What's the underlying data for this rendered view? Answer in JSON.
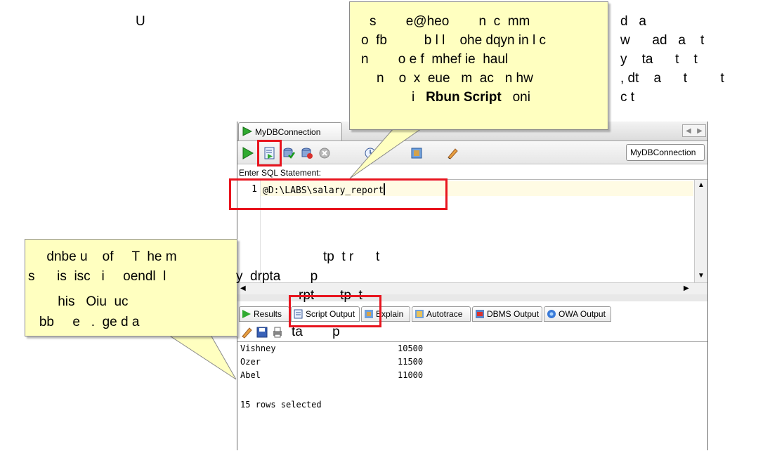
{
  "slide_text": {
    "top_left_fragment": "U",
    "right_fragments": [
      "d   a",
      "w      ad   a    t",
      "y    ta      t    t",
      ", dt    a      t         t",
      "c t"
    ]
  },
  "callout_top": {
    "lines": [
      "s        e@heo        n  c  mm",
      "o  fb          b l l    ohe dqyn in l c",
      "n        o e f  mhef ie  haul",
      "n    o  x  eue   m  ac   n hw"
    ],
    "last_line_pre": "i   ",
    "last_line_bold": "Rbun Script",
    "last_line_post": "   oni"
  },
  "callout_left": {
    "lines": [
      "     dnbe u    of     T  he m",
      "s      is  isc   i     oendl  l",
      "        his   Oiu  uc",
      "   bb     e   .  ge d a"
    ]
  },
  "overlay_fragments": {
    "mid1": "tp  t r      t",
    "mid2": "y  drpta        p",
    "mid3": "rpt       tp  t",
    "mid4": "ta        p"
  },
  "window": {
    "doc_tab_label": "MyDBConnection",
    "connection_selector": "MyDBConnection",
    "enter_sql_label": "Enter SQL Statement:",
    "editor": {
      "line_number": "1",
      "code": "@D:\\LABS\\salary_report"
    },
    "output_tabs": [
      {
        "label": "Results",
        "icon": "results-icon"
      },
      {
        "label": "Script Output",
        "icon": "script-output-icon"
      },
      {
        "label": "Explain",
        "icon": "explain-icon"
      },
      {
        "label": "Autotrace",
        "icon": "autotrace-icon"
      },
      {
        "label": "DBMS Output",
        "icon": "dbms-output-icon"
      },
      {
        "label": "OWA Output",
        "icon": "owa-output-icon"
      }
    ],
    "script_output": {
      "rows": [
        {
          "name": "Vishney",
          "value": "10500"
        },
        {
          "name": "Ozer",
          "value": "11500"
        },
        {
          "name": "Abel",
          "value": "11000"
        }
      ],
      "summary": "15 rows selected"
    }
  },
  "colors": {
    "callout_fill": "#ffffc0",
    "highlight": "#e8141e",
    "run_green": "#2faa2f"
  }
}
